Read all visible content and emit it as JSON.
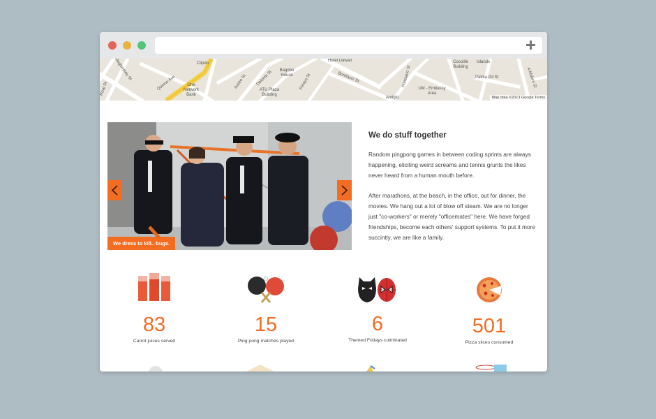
{
  "map": {
    "labels": [
      "Clipdo",
      "Bagobo House",
      "Hotel Dawan",
      "Cocolife Building",
      "Islands",
      "Palma Gil St",
      "A Mabini St",
      "Ponciano St",
      "UM - Embassy Area",
      "Bonifacio St",
      "Pelayo St",
      "ATU Plaza Building",
      "One Network Bank",
      "Ilustre St",
      "Delente St",
      "Quirino Ave",
      "Magsaysay St",
      "Amiglo",
      "Rizal St"
    ],
    "credit": "Map data ©2013 Google Terms"
  },
  "slider": {
    "caption": "We dress to kill.. bugs."
  },
  "story": {
    "title": "We do stuff together",
    "paragraph1": "Random pingpong games in between coding sprints are always happening, eliciting weird screams and tennis grunts the likes never heard from a human mouth before.",
    "paragraph2": "After marathons, at the beach, in the office, out for dinner, the movies. We hang out a lot of blow off steam. We are no longer just \"co-workers\" or merely \"officemates\" here. We have forged friendships, become each others' support systems. To put it more succintly, we are like a family."
  },
  "stats": [
    {
      "number": "83",
      "label": "Carrot juices served",
      "icon": "juice-glasses-icon"
    },
    {
      "number": "15",
      "label": "Ping pong matches played",
      "icon": "ping-pong-icon"
    },
    {
      "number": "6",
      "label": "Themed Fridays culminated",
      "icon": "superhero-masks-icon"
    },
    {
      "number": "501",
      "label": "Pizza slices consumed",
      "icon": "pizza-icon"
    }
  ],
  "colors": {
    "accent": "#f26c21",
    "background": "#aebcc4"
  }
}
